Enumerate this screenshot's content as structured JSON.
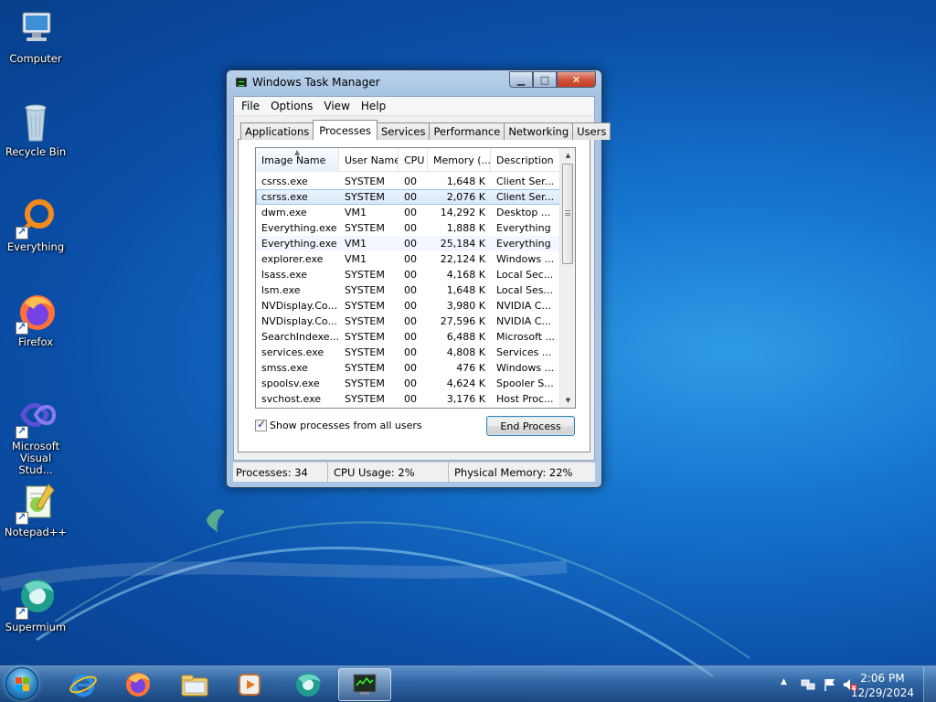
{
  "desktop": {
    "icons": [
      {
        "label": "Computer"
      },
      {
        "label": "Recycle Bin"
      },
      {
        "label": "Everything"
      },
      {
        "label": "Firefox"
      },
      {
        "label": "Microsoft Visual Stud..."
      },
      {
        "label": "Notepad++"
      },
      {
        "label": "Supermium"
      }
    ]
  },
  "window": {
    "title": "Windows Task Manager",
    "menu": [
      "File",
      "Options",
      "View",
      "Help"
    ],
    "tabs": [
      "Applications",
      "Processes",
      "Services",
      "Performance",
      "Networking",
      "Users"
    ],
    "active_tab": "Processes",
    "columns": [
      "Image Name",
      "User Name",
      "CPU",
      "Memory (...",
      "Description"
    ],
    "processes": [
      {
        "image": "csrss.exe",
        "user": "SYSTEM",
        "cpu": "00",
        "memory": "1,648 K",
        "description": "Client Ser..."
      },
      {
        "image": "csrss.exe",
        "user": "SYSTEM",
        "cpu": "00",
        "memory": "2,076 K",
        "description": "Client Ser..."
      },
      {
        "image": "dwm.exe",
        "user": "VM1",
        "cpu": "00",
        "memory": "14,292 K",
        "description": "Desktop ..."
      },
      {
        "image": "Everything.exe",
        "user": "SYSTEM",
        "cpu": "00",
        "memory": "1,888 K",
        "description": "Everything"
      },
      {
        "image": "Everything.exe",
        "user": "VM1",
        "cpu": "00",
        "memory": "25,184 K",
        "description": "Everything"
      },
      {
        "image": "explorer.exe",
        "user": "VM1",
        "cpu": "00",
        "memory": "22,124 K",
        "description": "Windows ..."
      },
      {
        "image": "lsass.exe",
        "user": "SYSTEM",
        "cpu": "00",
        "memory": "4,168 K",
        "description": "Local Sec..."
      },
      {
        "image": "lsm.exe",
        "user": "SYSTEM",
        "cpu": "00",
        "memory": "1,648 K",
        "description": "Local Ses..."
      },
      {
        "image": "NVDisplay.Co...",
        "user": "SYSTEM",
        "cpu": "00",
        "memory": "3,980 K",
        "description": "NVIDIA C..."
      },
      {
        "image": "NVDisplay.Co...",
        "user": "SYSTEM",
        "cpu": "00",
        "memory": "27,596 K",
        "description": "NVIDIA C..."
      },
      {
        "image": "SearchIndexe...",
        "user": "SYSTEM",
        "cpu": "00",
        "memory": "6,488 K",
        "description": "Microsoft ..."
      },
      {
        "image": "services.exe",
        "user": "SYSTEM",
        "cpu": "00",
        "memory": "4,808 K",
        "description": "Services ..."
      },
      {
        "image": "smss.exe",
        "user": "SYSTEM",
        "cpu": "00",
        "memory": "476 K",
        "description": "Windows ..."
      },
      {
        "image": "spoolsv.exe",
        "user": "SYSTEM",
        "cpu": "00",
        "memory": "4,624 K",
        "description": "Spooler S..."
      },
      {
        "image": "svchost.exe",
        "user": "SYSTEM",
        "cpu": "00",
        "memory": "3,176 K",
        "description": "Host Proc..."
      }
    ],
    "show_all_label": "Show processes from all users",
    "end_process_label": "End Process",
    "status": {
      "processes": "Processes: 34",
      "cpu": "CPU Usage: 2%",
      "memory": "Physical Memory: 22%"
    }
  },
  "taskbar": {
    "clock_time": "2:06 PM",
    "clock_date": "12/29/2024",
    "pinned": [
      "internet-explorer-icon",
      "firefox-icon",
      "file-explorer-icon",
      "media-player-icon",
      "supermium-icon",
      "task-manager-icon"
    ]
  },
  "colors": {
    "desktop_blue": "#1676cf",
    "window_frame": "#b9d1ea",
    "selection": "#d9e9f9",
    "close_red": "#c13e24"
  }
}
